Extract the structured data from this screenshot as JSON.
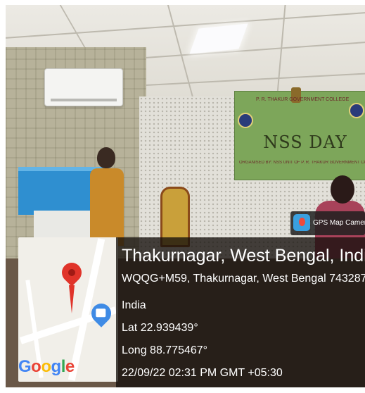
{
  "banner": {
    "title": "NSS DAY",
    "org": "P. R. THAKUR GOVERNMENT COLLEGE",
    "sub": "ORGANISED BY: NSS UNIT OF P. R. THAKUR GOVERNMENT COLLEGE"
  },
  "badge": {
    "label": "GPS Map Camera",
    "icon": "gps-map-camera-icon"
  },
  "location": {
    "title": "Thakurnagar, West Bengal, India",
    "address_line1": "WQQG+M59, Thakurnagar, West Bengal 743287,",
    "address_line2": "India",
    "lat": "Lat 22.939439°",
    "long": "Long 88.775467°",
    "datetime": "22/09/22 02:31 PM GMT +05:30"
  },
  "map": {
    "brand": "Google",
    "pin_color": "#e0342a",
    "shop_color": "#3f8be5"
  },
  "colors": {
    "google_g": "#4285f4",
    "google_o1": "#ea4335",
    "google_o2": "#fbbc05",
    "google_l": "#34a853"
  }
}
